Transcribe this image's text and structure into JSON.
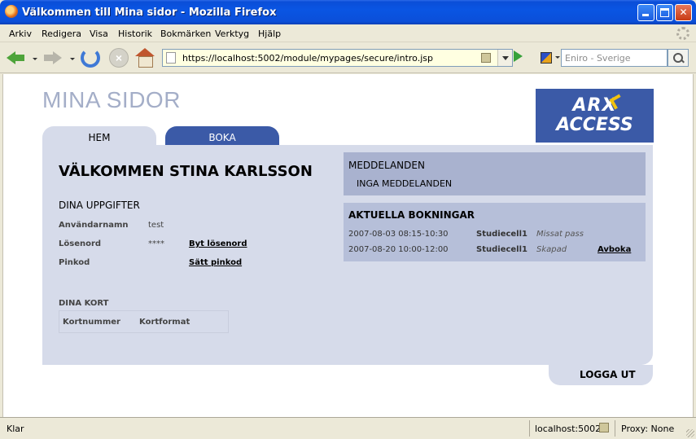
{
  "window": {
    "title": "Välkommen till Mina sidor - Mozilla Firefox"
  },
  "menu": [
    "Arkiv",
    "Redigera",
    "Visa",
    "Historik",
    "Bokmärken",
    "Verktyg",
    "Hjälp"
  ],
  "toolbar": {
    "url": "https://localhost:5002/module/mypages/secure/intro.jsp",
    "search_placeholder": "Eniro - Sverige"
  },
  "page": {
    "site_title": "MINA SIDOR",
    "logo_line1": "ARX",
    "logo_line2": "ACCESS",
    "tabs": [
      {
        "label": "HEM",
        "active": true
      },
      {
        "label": "BOKA",
        "active": false
      }
    ],
    "welcome": "VÄLKOMMEN STINA KARLSSON",
    "details": {
      "heading": "DINA UPPGIFTER",
      "username_label": "Användarnamn",
      "username_value": "test",
      "password_label": "Lösenord",
      "password_value": "****",
      "change_password_link": "Byt lösenord",
      "pin_label": "Pinkod",
      "set_pin_link": "Sätt pinkod"
    },
    "cards": {
      "heading": "DINA KORT",
      "columns": [
        "Kortnummer",
        "Kortformat"
      ]
    },
    "messages": {
      "heading": "MEDDELANDEN",
      "empty": "INGA MEDDELANDEN"
    },
    "bookings": {
      "heading": "AKTUELLA BOKNINGAR",
      "rows": [
        {
          "datetime": "2007-08-03 08:15-10:30",
          "room": "Studiecell1",
          "status": "Missat pass",
          "action": ""
        },
        {
          "datetime": "2007-08-20 10:00-12:00",
          "room": "Studiecell1",
          "status": "Skapad",
          "action": "Avboka"
        }
      ]
    },
    "logout": "LOGGA UT"
  },
  "statusbar": {
    "text": "Klar",
    "host": "localhost:5002",
    "proxy": "Proxy: None"
  }
}
